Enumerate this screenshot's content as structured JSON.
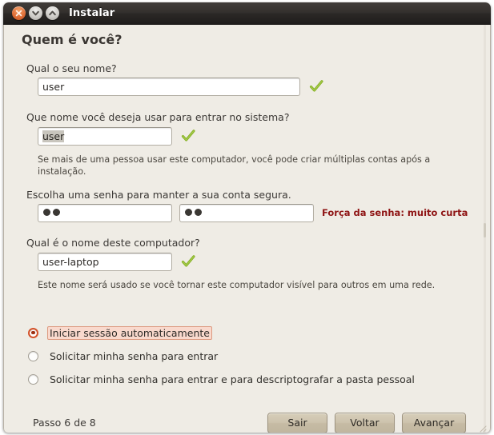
{
  "window": {
    "title": "Instalar",
    "buttons": {
      "close": "close-button",
      "minimize": "minimize-button",
      "maximize": "maximize-button"
    }
  },
  "page": {
    "heading": "Quem é você?"
  },
  "fields": {
    "fullname": {
      "label": "Qual o seu nome?",
      "value": "user",
      "valid_icon": "check-icon"
    },
    "username": {
      "label": "Que nome você deseja usar para entrar no sistema?",
      "value": "user",
      "valid_icon": "check-icon",
      "help": "Se mais de uma pessoa usar este computador, você pode criar múltiplas contas após a instalação."
    },
    "password": {
      "label": "Escolha uma senha para manter a sua conta segura.",
      "value_dots": 2,
      "confirm_dots": 2,
      "strength_text": "Força da senha: muito curta",
      "strength_color": "#8f1515"
    },
    "hostname": {
      "label": "Qual é o nome deste computador?",
      "value": "user-laptop",
      "valid_icon": "check-icon",
      "help": "Este nome será usado se você tornar este computador visível para outros em uma rede."
    }
  },
  "login_options": [
    {
      "label": "Iniciar sessão automaticamente",
      "selected": true,
      "focused": true
    },
    {
      "label": "Solicitar minha senha para entrar",
      "selected": false,
      "focused": false
    },
    {
      "label": "Solicitar minha senha para entrar e para descriptografar a pasta pessoal",
      "selected": false,
      "focused": false
    }
  ],
  "footer": {
    "step": "Passo 6 de 8",
    "quit": "Sair",
    "back": "Voltar",
    "next": "Avançar"
  },
  "colors": {
    "accent_orange": "#d4522a",
    "window_bg": "#efece5",
    "titlebar": "#2b2826",
    "check_green": "#86b023",
    "error_red": "#8f1515"
  }
}
